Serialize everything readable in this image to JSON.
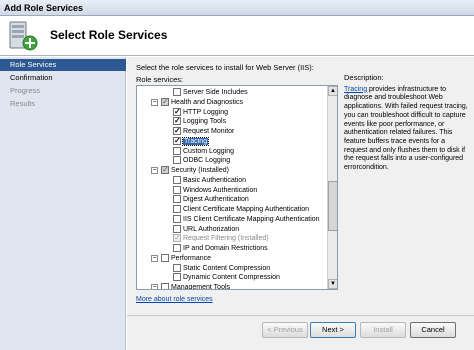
{
  "window": {
    "title": "Add Role Services"
  },
  "header": {
    "title": "Select Role Services"
  },
  "sidebar": {
    "items": [
      {
        "label": "Role Services",
        "state": "active"
      },
      {
        "label": "Confirmation",
        "state": "normal"
      },
      {
        "label": "Progress",
        "state": "muted"
      },
      {
        "label": "Results",
        "state": "muted"
      }
    ]
  },
  "main": {
    "instruction": "Select the role services to install for Web Server (IIS):",
    "list_label": "Role services:",
    "more_link": "More about role services"
  },
  "tree": [
    {
      "label": "Server Side Includes",
      "check": "none"
    },
    {
      "label": "Health and Diagnostics",
      "check": "partial",
      "expander": "⊟"
    },
    {
      "label": "HTTP Logging",
      "check": "checked"
    },
    {
      "label": "Logging Tools",
      "check": "checked"
    },
    {
      "label": "Request Monitor",
      "check": "checked"
    },
    {
      "label": "Tracing",
      "check": "checked",
      "selected": true
    },
    {
      "label": "Custom Logging",
      "check": "none"
    },
    {
      "label": "ODBC Logging",
      "check": "none"
    },
    {
      "label": "Security  (Installed)",
      "check": "partial",
      "expander": "⊟"
    },
    {
      "label": "Basic Authentication",
      "check": "none"
    },
    {
      "label": "Windows Authentication",
      "check": "none"
    },
    {
      "label": "Digest Authentication",
      "check": "none"
    },
    {
      "label": "Client Certificate Mapping Authentication",
      "check": "none"
    },
    {
      "label": "IIS Client Certificate Mapping Authentication",
      "check": "none"
    },
    {
      "label": "URL Authorization",
      "check": "none"
    },
    {
      "label": "Request Filtering  (Installed)",
      "check": "disabled",
      "gray": true
    },
    {
      "label": "IP and Domain Restrictions",
      "check": "none"
    },
    {
      "label": "Performance",
      "check": "none",
      "expander": "⊟"
    },
    {
      "label": "Static Content Compression",
      "check": "none"
    },
    {
      "label": "Dynamic Content Compression",
      "check": "none"
    },
    {
      "label": "Management Tools",
      "check": "none",
      "expander": "⊟"
    }
  ],
  "description": {
    "title": "Description:",
    "link": "Tracing",
    "text": " provides infrastructure to diagnose and troubleshoot Web applications. With failed request tracing, you can troubleshoot difficult to capture events like poor performance, or authentication related failures. This feature buffers trace events for a request and only flushes them to disk if the request falls into a user-configured errorcondition."
  },
  "buttons": {
    "previous": "< Previous",
    "next": "Next >",
    "install": "Install",
    "cancel": "Cancel"
  },
  "icons": {
    "header": "server-add-icon"
  }
}
